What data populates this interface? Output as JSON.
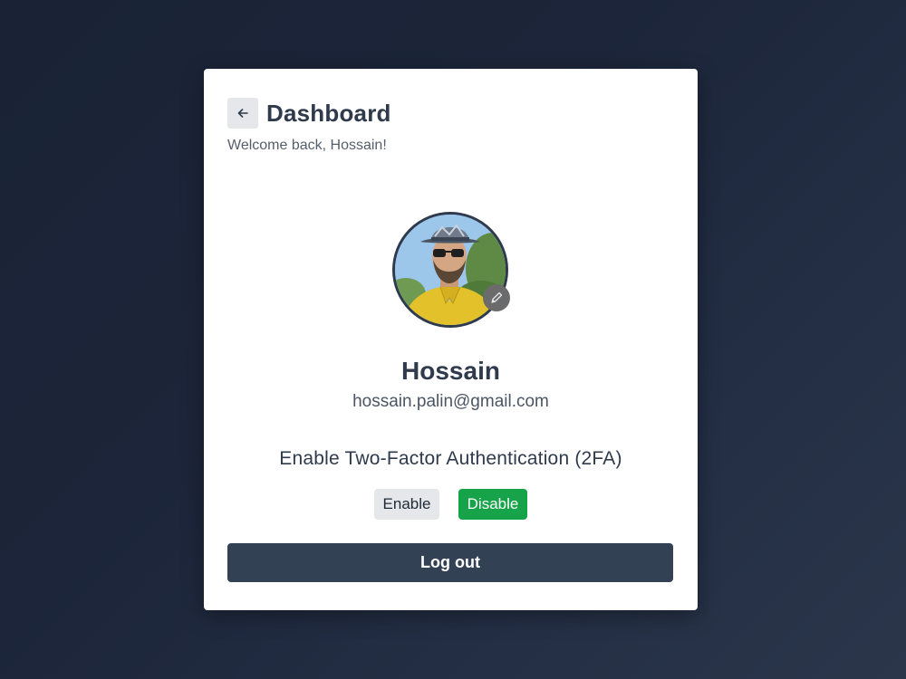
{
  "header": {
    "back_icon": "arrow-left-icon",
    "title": "Dashboard",
    "welcome": "Welcome back, Hossain!"
  },
  "profile": {
    "avatar_alt": "Profile photo",
    "edit_icon": "pencil-icon",
    "name": "Hossain",
    "email": "hossain.palin@gmail.com"
  },
  "two_factor": {
    "label": "Enable Two-Factor Authentication (2FA)",
    "enable_label": "Enable",
    "disable_label": "Disable"
  },
  "logout_label": "Log out",
  "colors": {
    "background": "#1c2539",
    "card": "#ffffff",
    "text_primary": "#2f3a4c",
    "enable_button": "#e5e7eb",
    "disable_button": "#16a34a",
    "logout_button": "#334155"
  }
}
